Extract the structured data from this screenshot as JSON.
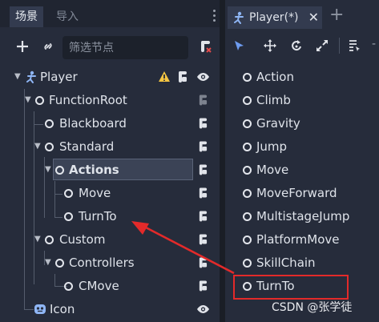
{
  "scene_dock": {
    "tabs": [
      {
        "label": "场景"
      },
      {
        "label": "导入"
      }
    ],
    "filter_placeholder": "筛选节点",
    "tree": [
      {
        "label": "Player"
      },
      {
        "label": "FunctionRoot"
      },
      {
        "label": "Blackboard"
      },
      {
        "label": "Standard"
      },
      {
        "label": "Actions"
      },
      {
        "label": "Move"
      },
      {
        "label": "TurnTo"
      },
      {
        "label": "Custom"
      },
      {
        "label": "Controllers"
      },
      {
        "label": "CMove"
      },
      {
        "label": "Icon"
      }
    ]
  },
  "player_dock": {
    "tab_label": "Player(*)",
    "items": [
      {
        "label": "Action"
      },
      {
        "label": "Climb"
      },
      {
        "label": "Gravity"
      },
      {
        "label": "Jump"
      },
      {
        "label": "Move"
      },
      {
        "label": "MoveForward"
      },
      {
        "label": "MultistageJump"
      },
      {
        "label": "PlatformMove"
      },
      {
        "label": "SkillChain"
      },
      {
        "label": "TurnTo"
      }
    ]
  },
  "watermark": "CSDN @张学徒",
  "colors": {
    "annotation_red": "#e32a2a",
    "selected_row": "#3b4356",
    "panel_bg": "#262c3b",
    "warning_yellow": "#f5c542",
    "accent_blue": "#8fb6f5"
  }
}
